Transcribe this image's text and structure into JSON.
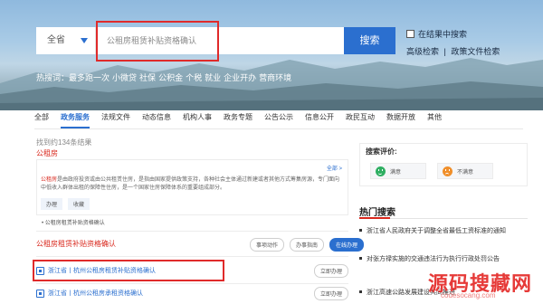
{
  "search": {
    "scope_label": "全省",
    "placeholder": "公租房租赁补贴资格确认",
    "submit_label": "搜索",
    "in_results_label": "在结果中搜索",
    "advanced_label": "高级检索",
    "policy_search_label": "政策文件检索",
    "link_separator": "|"
  },
  "hot_words": {
    "label": "热搜词：",
    "items": [
      "最多跑一次",
      "小微贷",
      "社保",
      "公积金",
      "个税",
      "就业",
      "企业开办",
      "营商环境"
    ]
  },
  "tabs": [
    "全部",
    "政务服务",
    "法规文件",
    "动态信息",
    "机构人事",
    "政务专题",
    "公告公示",
    "信息公开",
    "政民互动",
    "数据开放",
    "其他"
  ],
  "active_tab_index": 1,
  "result_count_text": "找到约134条结果",
  "results": {
    "card1": {
      "title": "公租房",
      "more_label": "全部 >",
      "subtitle": "",
      "desc_highlight": "公租房",
      "desc_rest": "是由政府投资或由公共租赁住房，是指由国家提供政策支持，各种社会主体通过新建或者其他方式筹集房源，专门面向中低收入群体出租的保障性住房，是一个国家住房保障体系的重要组成部分。",
      "chips": [
        "办理",
        "收藏"
      ]
    },
    "list_item": "公租房租赁补贴资格确认",
    "group_title": "公租房租赁补贴资格确认",
    "group_actions": [
      "事项动作",
      "办事指南",
      "在线办理"
    ],
    "sub_items": [
      {
        "label": "浙江省丨杭州公租房租赁补贴资格确认",
        "action": "立即办理"
      },
      {
        "label": "浙江省丨杭州公租房承租资格确认",
        "action": "立即办理"
      }
    ]
  },
  "feedback": {
    "title": "搜索评价:",
    "satisfied": "满意",
    "unsatisfied": "不满意"
  },
  "hot_search": {
    "title": "热门搜索",
    "items": [
      "浙江省人民政府关于调整全省最低工资标准的通知",
      "对张方禄实施的交通违法行为执行行政处罚公告",
      "浙江高速公路发展建设共同推进"
    ]
  },
  "watermark": {
    "main": "源码搜藏网",
    "sub": "codesocang.com"
  },
  "colors": {
    "accent": "#2b6fcf",
    "highlight": "#d9281d",
    "annotation": "#e02a2a"
  }
}
